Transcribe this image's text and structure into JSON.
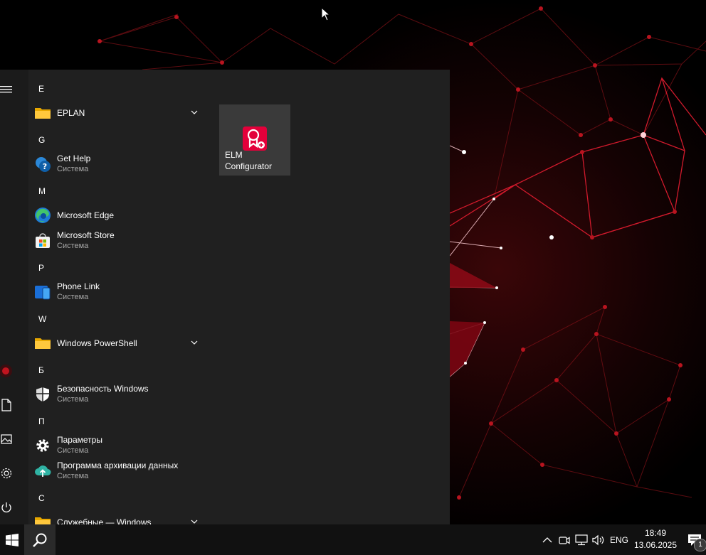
{
  "start_menu": {
    "sections": [
      {
        "letter": "E",
        "apps": [
          {
            "name": "EPLAN",
            "subtitle": "",
            "icon": "folder-icon",
            "expandable": true
          }
        ]
      },
      {
        "letter": "G",
        "apps": [
          {
            "name": "Get Help",
            "subtitle": "Система",
            "icon": "get-help-icon",
            "expandable": false
          }
        ]
      },
      {
        "letter": "M",
        "apps": [
          {
            "name": "Microsoft Edge",
            "subtitle": "",
            "icon": "edge-icon",
            "expandable": false
          },
          {
            "name": "Microsoft Store",
            "subtitle": "Система",
            "icon": "store-icon",
            "expandable": false
          }
        ]
      },
      {
        "letter": "P",
        "apps": [
          {
            "name": "Phone Link",
            "subtitle": "Система",
            "icon": "phone-link-icon",
            "expandable": false
          }
        ]
      },
      {
        "letter": "W",
        "apps": [
          {
            "name": "Windows PowerShell",
            "subtitle": "",
            "icon": "folder-icon",
            "expandable": true
          }
        ]
      },
      {
        "letter": "Б",
        "apps": [
          {
            "name": "Безопасность Windows",
            "subtitle": "Система",
            "icon": "shield-icon",
            "expandable": false
          }
        ]
      },
      {
        "letter": "П",
        "apps": [
          {
            "name": "Параметры",
            "subtitle": "Система",
            "icon": "gear-icon",
            "expandable": false
          },
          {
            "name": "Программа архивации данных",
            "subtitle": "Система",
            "icon": "backup-icon",
            "expandable": false
          }
        ]
      },
      {
        "letter": "С",
        "apps": [
          {
            "name": "Служебные — Windows",
            "subtitle": "",
            "icon": "folder-icon",
            "expandable": true
          }
        ]
      }
    ],
    "tile": {
      "label_line1": "ELM",
      "label_line2": "Configurator",
      "icon": "elm-configurator-icon",
      "color": "#e3003a"
    },
    "rail_icons": [
      "hamburger-menu-icon",
      "user-avatar-icon",
      "document-icon",
      "pictures-icon",
      "gear-icon",
      "power-icon"
    ]
  },
  "taskbar": {
    "language": "ENG",
    "time": "18:49",
    "date": "13.06.2025",
    "notification_count": "1"
  },
  "colors": {
    "start_bg": "#202020",
    "taskbar_bg": "#111111",
    "tile_bg": "#3a3a3a",
    "accent_red": "#e3003a"
  }
}
